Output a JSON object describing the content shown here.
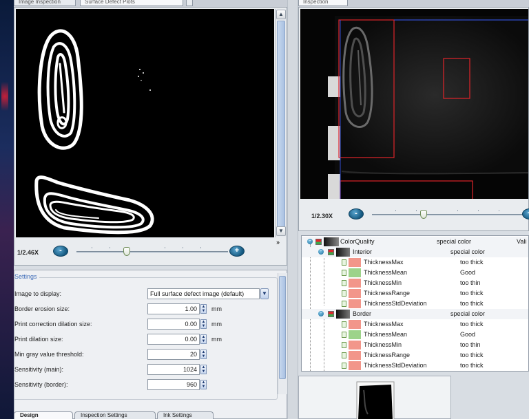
{
  "left_viewer": {
    "tabs": [
      "Image Inspection",
      "Surface Defect Plots"
    ],
    "zoom_label": "1/2.46X",
    "zoom_minus": "-",
    "zoom_plus": "+",
    "zoom_level": 0.4,
    "expand_chevron": "»"
  },
  "settings": {
    "title": "Settings",
    "fields": [
      {
        "label": "Image to display:",
        "value": "Full surface defect image (default)",
        "unit": ""
      },
      {
        "label": "Border erosion size:",
        "value": "1.00",
        "unit": "mm"
      },
      {
        "label": "Print correction dilation size:",
        "value": "0.00",
        "unit": "mm"
      },
      {
        "label": "Print dilation size:",
        "value": "0.00",
        "unit": "mm"
      },
      {
        "label": "Min gray value threshold:",
        "value": "20",
        "unit": ""
      },
      {
        "label": "Sensitivity (main):",
        "value": "1024",
        "unit": ""
      },
      {
        "label": "Sensitivity (border):",
        "value": "960",
        "unit": ""
      }
    ],
    "bottom_tabs": [
      "Design",
      "Inspection Settings",
      "Ink Settings"
    ]
  },
  "right_viewer": {
    "tab": "Inspection",
    "zoom_label": "1/2.30X",
    "zoom_level": 0.5
  },
  "tree": {
    "header": {
      "name": "ColorQuality",
      "value": "special color",
      "extra": "Vali"
    },
    "groups": [
      {
        "name": "Interior",
        "value": "special color",
        "items": [
          {
            "name": "ThicknessMax",
            "value": "too thick",
            "status": "bad"
          },
          {
            "name": "ThicknessMean",
            "value": "Good",
            "status": "good"
          },
          {
            "name": "ThicknessMin",
            "value": "too thin",
            "status": "bad"
          },
          {
            "name": "ThicknessRange",
            "value": "too thick",
            "status": "bad"
          },
          {
            "name": "ThicknessStdDeviation",
            "value": "too thick",
            "status": "bad"
          }
        ]
      },
      {
        "name": "Border",
        "value": "special color",
        "items": [
          {
            "name": "ThicknessMax",
            "value": "too thick",
            "status": "bad"
          },
          {
            "name": "ThicknessMean",
            "value": "Good",
            "status": "good"
          },
          {
            "name": "ThicknessMin",
            "value": "too thin",
            "status": "bad"
          },
          {
            "name": "ThicknessRange",
            "value": "too thick",
            "status": "bad"
          },
          {
            "name": "ThicknessStdDeviation",
            "value": "too thick",
            "status": "bad"
          }
        ]
      }
    ]
  },
  "colors": {
    "bad": "#f2968a",
    "good": "#9dd38a",
    "accent": "#1c6f9e",
    "roi": "#e0242a"
  }
}
